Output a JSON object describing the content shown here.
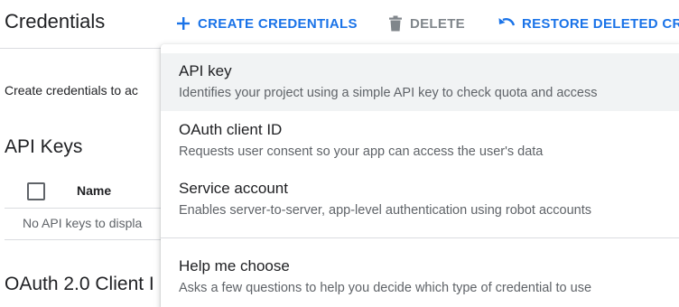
{
  "header": {
    "title": "Credentials",
    "actions": {
      "create": {
        "label": "CREATE CREDENTIALS",
        "icon": "plus-icon",
        "color": "#1a73e8"
      },
      "delete": {
        "label": "DELETE",
        "icon": "trash-icon",
        "color": "#80868b"
      },
      "restore": {
        "label": "RESTORE DELETED CRE",
        "icon": "undo-icon",
        "color": "#1a73e8"
      }
    }
  },
  "main": {
    "intro_text": "Create credentials to ac",
    "api_keys": {
      "title": "API Keys",
      "column_name": "Name",
      "empty_text": "No API keys to displa"
    },
    "oauth_title": "OAuth 2.0 Client I"
  },
  "menu": {
    "items": [
      {
        "title": "API key",
        "description": "Identifies your project using a simple API key to check quota and access",
        "highlighted": true
      },
      {
        "title": "OAuth client ID",
        "description": "Requests user consent so your app can access the user's data"
      },
      {
        "title": "Service account",
        "description": "Enables server-to-server, app-level authentication using robot accounts"
      },
      {
        "title": "Help me choose",
        "description": "Asks a few questions to help you decide which type of credential to use"
      }
    ]
  },
  "colors": {
    "accent": "#1a73e8",
    "muted": "#5f6368",
    "highlight_bg": "#f1f3f4",
    "divider": "#dadce0"
  }
}
